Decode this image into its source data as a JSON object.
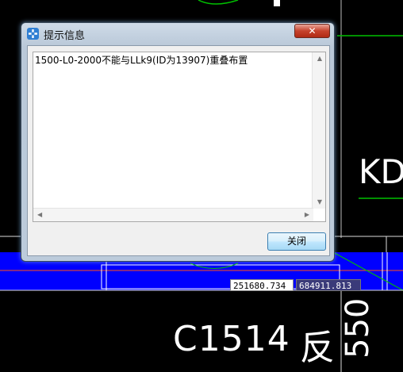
{
  "dialog": {
    "title": "提示信息",
    "close_symbol": "✕",
    "message": "1500-L0-2000不能与LLk9(ID为13907)重叠布置",
    "ok_label": "关闭"
  },
  "cad": {
    "label_kd": "KD",
    "label_c1514": "C1514",
    "label_fan": "反",
    "label_550": "550",
    "coord_x": "251680.734",
    "coord_y": "684911.813"
  },
  "colors": {
    "blue_band": "#0000ff",
    "green_line": "#00c000",
    "close_red": "#c6422c",
    "title_bar": "#bccbdb"
  },
  "icons": {
    "app": "app-icon",
    "close": "close-icon",
    "scroll_up": "scroll-up-icon",
    "scroll_down": "scroll-down-icon",
    "scroll_left": "scroll-left-icon",
    "scroll_right": "scroll-right-icon"
  }
}
